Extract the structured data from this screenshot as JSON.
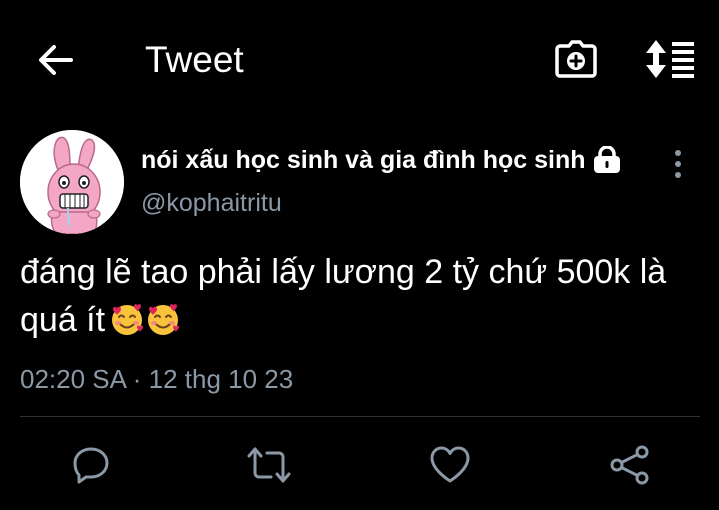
{
  "header": {
    "back_icon": "arrow-left-icon",
    "title": "Tweet",
    "camera_icon": "camera-add-icon",
    "sort_icon": "sort-list-icon"
  },
  "tweet": {
    "author": {
      "display_name": "nói xấu học sinh và gia đình học sinh",
      "handle": "@kophaitritu",
      "protected_icon": "lock-icon",
      "avatar_icon": "pink-bunny-avatar"
    },
    "text": "đáng lẽ tao phải lấy lương 2 tỷ chứ 500k là quá ít",
    "emojis": [
      "smiling-face-with-hearts",
      "smiling-face-with-hearts"
    ],
    "timestamp": "02:20 SA · 12 thg 10 23"
  },
  "actions": {
    "reply_icon": "reply-bubble-icon",
    "retweet_icon": "retweet-icon",
    "like_icon": "heart-icon",
    "share_icon": "share-icon"
  },
  "colors": {
    "background": "#000000",
    "text_primary": "#ffffff",
    "text_secondary": "#8b98a5",
    "divider": "#2f3336",
    "avatar_pink": "#f4a7c5"
  }
}
